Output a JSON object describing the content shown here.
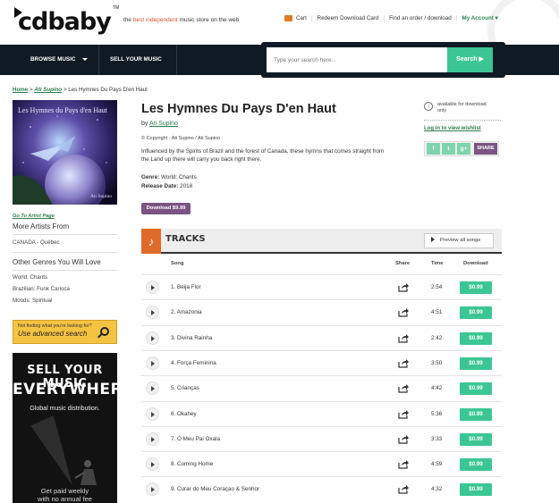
{
  "header": {
    "logo_text": "cdbaby",
    "logo_tm": "TM",
    "tagline_pre": "the ",
    "tagline_highlight": "best independent",
    "tagline_post": " music store on the web",
    "nav": {
      "cart": "Cart",
      "redeem": "Redeem Download Card",
      "find_order": "Find an order / download",
      "account": "My Account"
    },
    "accent_color": "#e0502a"
  },
  "navbar": {
    "browse": "BROWSE MUSIC",
    "sell": "SELL YOUR MUSIC",
    "search_placeholder": "Type your search here...",
    "search_button": "Search ▶"
  },
  "breadcrumb": {
    "home": "Home",
    "artist": "Ati Supino",
    "current": "Les Hymnes Du Pays D'en Haut"
  },
  "album": {
    "cover_title": "Les Hymnes du Pays d'en Haut",
    "cover_sub": "Ati Supino",
    "title": "Les Hymnes Du Pays D'en Haut",
    "by_label": "by ",
    "artist": "Ati Supino",
    "copyright": "© Copyright - Ati Supino / Ati Supino",
    "description": "Influenced by the Spirits of Brazil and the forest of Canada, these hymns that comes straight from the Land up there will carry you back right there.",
    "genre_label": "Genre:",
    "genre": " World: Chants",
    "release_label": "Release Date:",
    "release": " 2018",
    "download_button": "Download $9.99"
  },
  "aside": {
    "available_line1": "available for download",
    "available_line2": "only",
    "wishlist": "Log in to view wishlist",
    "social": [
      "f",
      "t",
      "g+"
    ],
    "share": "SHARE"
  },
  "sidebar": {
    "go_to_artist": "Go To Artist Page",
    "more_artists": "More Artists From",
    "region": "CANADA - Québec",
    "other_genres": "Other Genres You Will Love",
    "genres": [
      "World: Chants",
      "Brazilian: Funk Carioca",
      "Moods: Spiritual"
    ],
    "adv_line1": "Not finding what you're looking for?",
    "adv_line2": "Use advanced search"
  },
  "ad": {
    "line1": "SELL YOUR MUSIC",
    "line2": "EVERYWHERE",
    "sub": "Global music distribution.",
    "foot1": "Get paid weekly",
    "foot2": "with no annual fee"
  },
  "tracks": {
    "heading": "TRACKS",
    "preview": "Preview all songs",
    "columns": {
      "song": "Song",
      "share": "Share",
      "time": "Time",
      "download": "Download"
    },
    "items": [
      {
        "name": "1. Beija Flor",
        "time": "2:54",
        "price": "$0.99"
      },
      {
        "name": "2. Amazonia",
        "time": "4:51",
        "price": "$0.99"
      },
      {
        "name": "3. Divina Rainha",
        "time": "2:42",
        "price": "$0.99"
      },
      {
        "name": "4. Força Feminina",
        "time": "3:50",
        "price": "$0.99"
      },
      {
        "name": "5. Crianças",
        "time": "4:42",
        "price": "$0.99"
      },
      {
        "name": "6. Okahey",
        "time": "5:36",
        "price": "$0.99"
      },
      {
        "name": "7. O Meu Pai Oxala",
        "time": "3:33",
        "price": "$0.99"
      },
      {
        "name": "8. Coming Home",
        "time": "4:59",
        "price": "$0.99"
      },
      {
        "name": "9. Curar do Meu Coraçao & Senhor",
        "time": "4:32",
        "price": "$0.99"
      }
    ]
  }
}
